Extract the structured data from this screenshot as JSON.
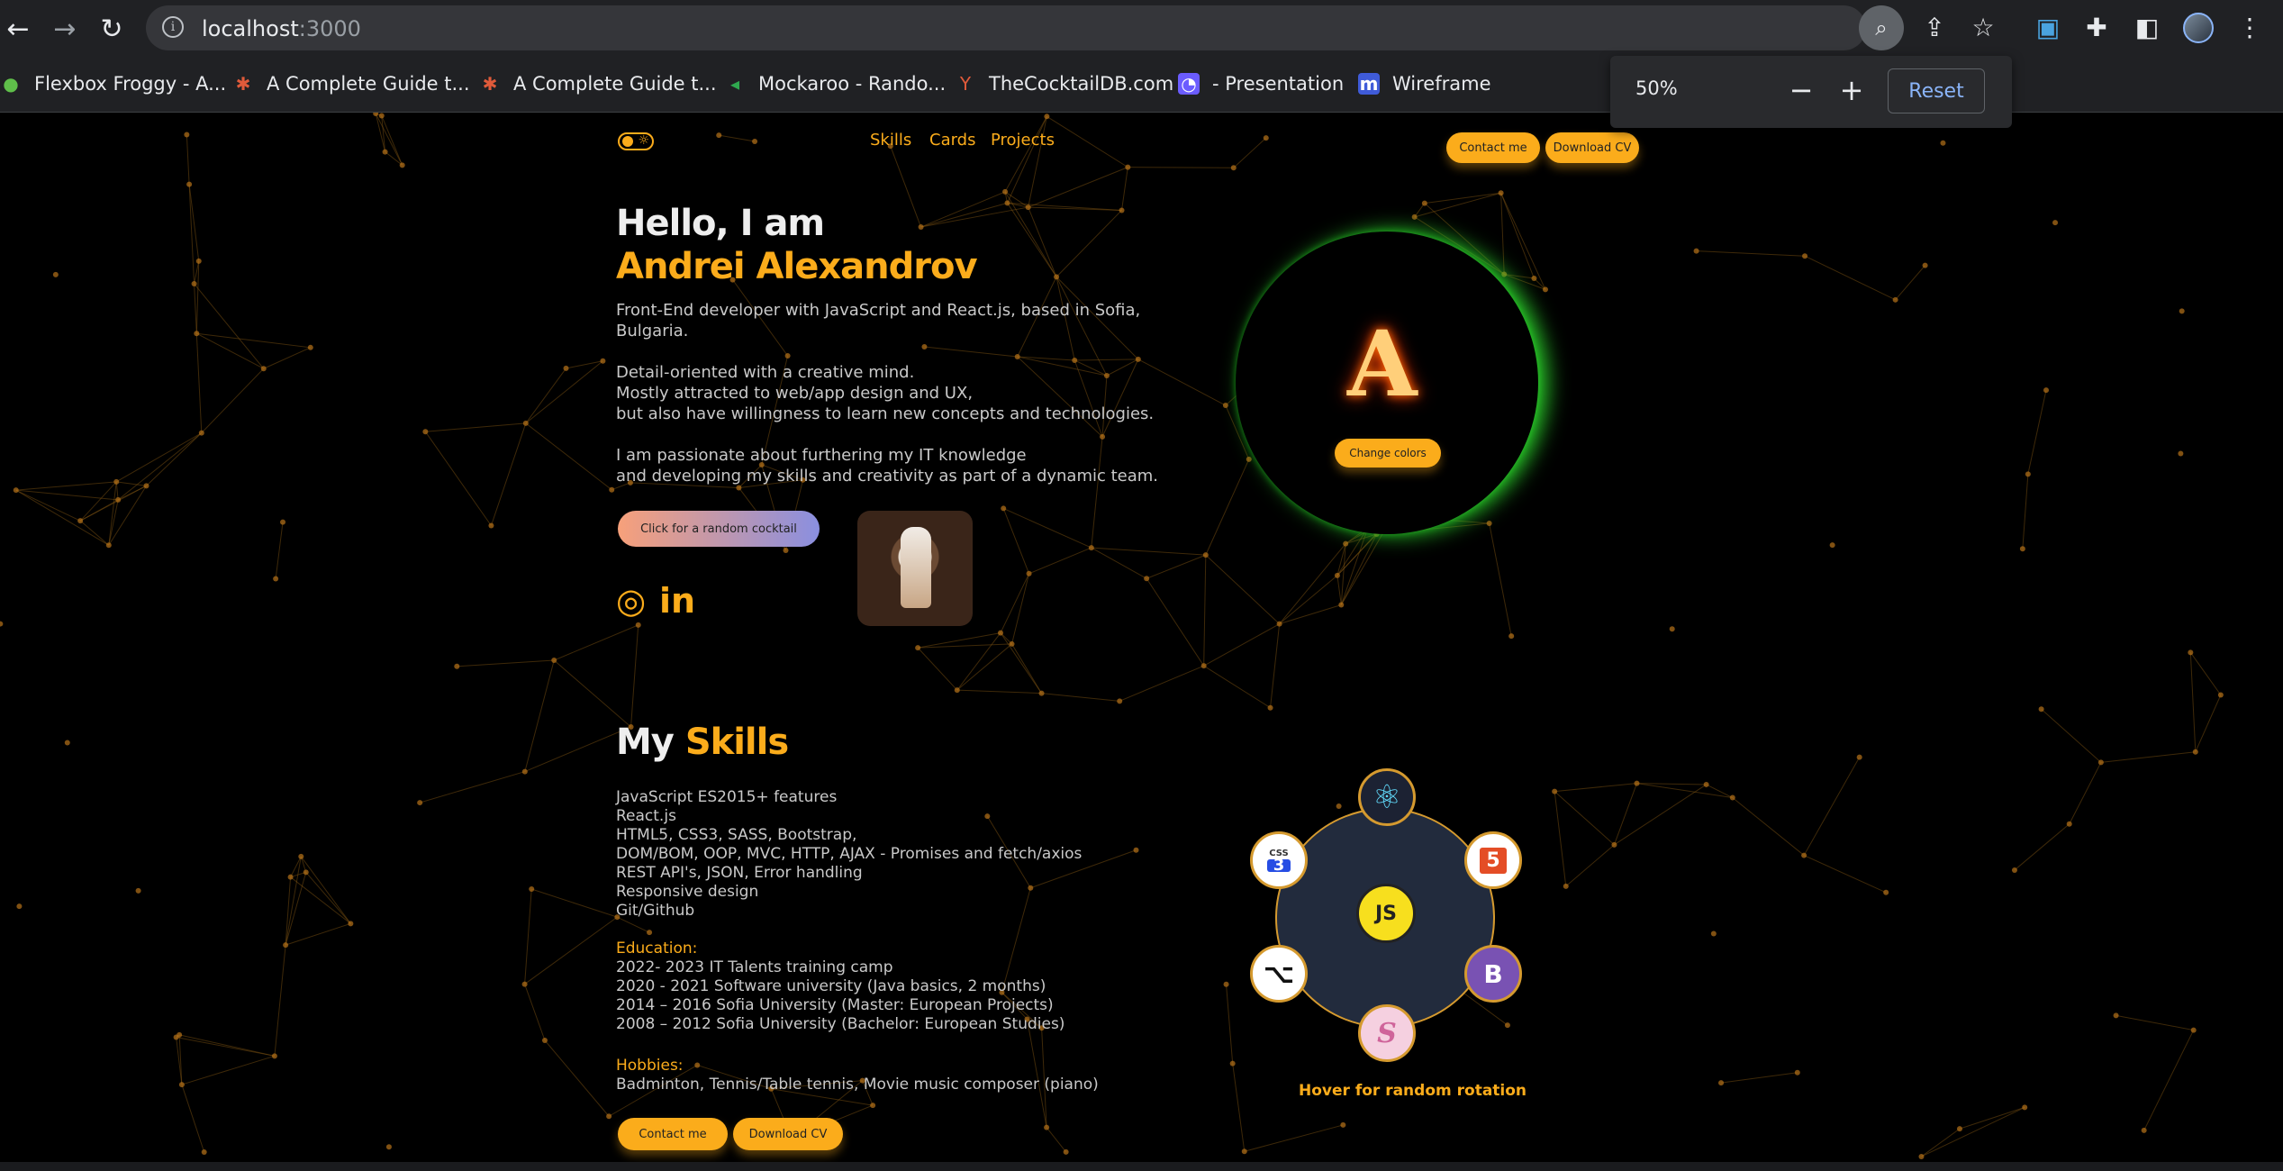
{
  "browser": {
    "url_host": "localhost",
    "url_port": ":3000",
    "bookmarks": [
      {
        "label": "Flexbox Froggy - A...",
        "icon": "frog-icon"
      },
      {
        "label": "A Complete Guide t...",
        "icon": "asterisk-icon"
      },
      {
        "label": "A Complete Guide t...",
        "icon": "asterisk-icon"
      },
      {
        "label": "Mockaroo - Rando...",
        "icon": "arrow-icon"
      },
      {
        "label": "TheCocktailDB.com",
        "icon": "cocktail-icon"
      },
      {
        "label": "- Presentation",
        "icon": "presentation-icon"
      },
      {
        "label": "Wireframe",
        "icon": "m-icon"
      }
    ],
    "zoom": {
      "percent": "50%",
      "reset_label": "Reset",
      "minus": "−",
      "plus": "+"
    }
  },
  "nav": {
    "links": [
      "Skills",
      "Cards",
      "Projects"
    ],
    "contact": "Contact me",
    "download": "Download CV"
  },
  "hero": {
    "greeting": "Hello, I am",
    "name": "Andrei Alexandrov",
    "bio1a": "Front-End developer with JavaScript and React.js, based in Sofia,",
    "bio1b": "Bulgaria.",
    "bio2a": "Detail-oriented with a creative mind.",
    "bio2b": "Mostly attracted to web/app design and UX,",
    "bio2c": "but also have willingness to learn new concepts and technologies.",
    "bio3a": "I am passionate about furthering my IT knowledge",
    "bio3b": "and developing my skills and creativity as part of a dynamic team.",
    "cocktail_button": "Click for a random cocktail",
    "change_colors": "Change colors",
    "monogram": "A"
  },
  "skills": {
    "title_prefix": "My ",
    "title_highlight": "Skills",
    "items": [
      "JavaScript ES2015+ features",
      "React.js",
      "HTML5, CSS3, SASS, Bootstrap,",
      "DOM/BOM, OOP, MVC, HTTP, AJAX - Promises and fetch/axios",
      "REST API's, JSON, Error handling",
      "Responsive design",
      "Git/Github"
    ],
    "education_label": "Education:",
    "education": [
      "2022- 2023 IT Talents training camp",
      "2020 - 2021 Software university (Java basics, 2 months)",
      "2014 – 2016 Sofia University (Master: European Projects)",
      "2008 – 2012 Sofia University (Bachelor: European Studies)"
    ],
    "hobbies_label": "Hobbies:",
    "hobbies": "Badminton, Tennis/Table tennis, Movie music composer (piano)",
    "contact": "Contact me",
    "download": "Download CV",
    "wheel_icons": {
      "react": "⚛",
      "html": "5",
      "css": "3",
      "css_tag": "CSS",
      "bootstrap": "B",
      "sass": "S",
      "github": "⌥",
      "js": "JS"
    },
    "hover_label": "Hover for random rotation"
  },
  "colors": {
    "accent": "#fbac1b",
    "background": "#000000",
    "glow": "#2bd12b"
  }
}
